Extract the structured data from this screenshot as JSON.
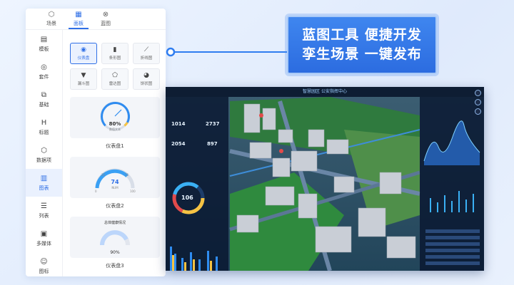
{
  "top_tabs": [
    {
      "label": "场景",
      "icon": "cube-icon",
      "glyph": "⬡",
      "active": false
    },
    {
      "label": "面板",
      "icon": "panel-icon",
      "glyph": "▦",
      "active": true
    },
    {
      "label": "蓝图",
      "icon": "blueprint-icon",
      "glyph": "⊗",
      "active": false
    }
  ],
  "side_nav": [
    {
      "label": "模板",
      "icon": "template-icon",
      "glyph": "▤"
    },
    {
      "label": "套件",
      "icon": "kit-icon",
      "glyph": "◎"
    },
    {
      "label": "基础",
      "icon": "basic-icon",
      "glyph": "⧉"
    },
    {
      "label": "标题",
      "icon": "title-icon",
      "glyph": "H"
    },
    {
      "label": "数据项",
      "icon": "data-item-icon",
      "glyph": "⬡"
    },
    {
      "label": "图表",
      "icon": "chart-icon",
      "glyph": "▥",
      "active": true
    },
    {
      "label": "列表",
      "icon": "list-icon",
      "glyph": "☰"
    },
    {
      "label": "多媒体",
      "icon": "media-icon",
      "glyph": "▣"
    },
    {
      "label": "图标",
      "icon": "emoji-icon",
      "glyph": "☺"
    }
  ],
  "chart_types": [
    {
      "label": "仪表盘",
      "icon": "gauge-icon",
      "glyph": "◉",
      "active": true
    },
    {
      "label": "条形图",
      "icon": "bar-chart-icon",
      "glyph": "▮"
    },
    {
      "label": "折线图",
      "icon": "line-chart-icon",
      "glyph": "⟋"
    },
    {
      "label": "漏斗图",
      "icon": "funnel-icon",
      "glyph": "▼"
    },
    {
      "label": "雷达图",
      "icon": "radar-icon",
      "glyph": "⬠"
    },
    {
      "label": "饼状图",
      "icon": "pie-chart-icon",
      "glyph": "◕"
    }
  ],
  "gauges": [
    {
      "caption": "仪表盘1",
      "value_text": "80%",
      "sub_text": "数值文本",
      "value": 0.8
    },
    {
      "caption": "仪表盘2",
      "value_text": "74",
      "sub_text": "NUM",
      "value": 0.74,
      "ticks": [
        "0",
        "25",
        "75",
        "100"
      ]
    },
    {
      "caption": "仪表盘3",
      "value_text": "90%",
      "title": "总体健康情况",
      "value": 0.9
    }
  ],
  "headline": {
    "line1": "蓝图工具 便捷开发",
    "line2": "孪生场景 一键发布"
  },
  "dashboard": {
    "title": "智慧园区 公安指挥中心",
    "stats": [
      "1014",
      "2737",
      "2054",
      "897"
    ],
    "ring_value": "106"
  },
  "colors": {
    "accent": "#2f6fe6",
    "headline_bg": "#2c6ce0"
  }
}
